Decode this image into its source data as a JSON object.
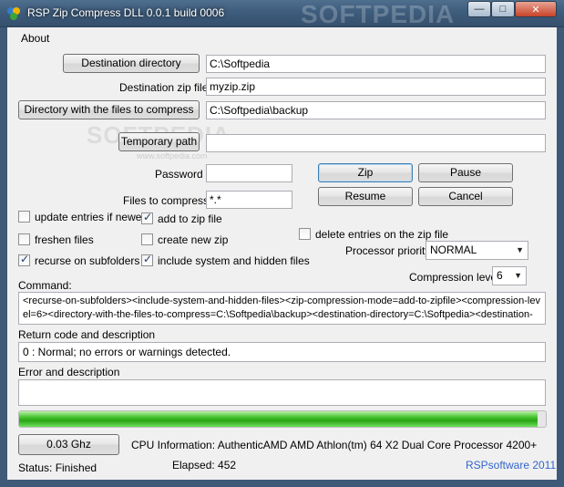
{
  "window": {
    "title": "RSP Zip Compress DLL 0.0.1 build 0006",
    "watermark": "SOFTPEDIA",
    "minimize_glyph": "—",
    "maximize_glyph": "□",
    "close_glyph": "✕"
  },
  "menu": {
    "about": "About"
  },
  "buttons": {
    "destination_directory": "Destination directory",
    "directory_with_files": "Directory with the files to compress",
    "temporary_path": "Temporary path",
    "zip": "Zip",
    "pause": "Pause",
    "resume": "Resume",
    "cancel": "Cancel",
    "cpu_speed": "0.03 Ghz"
  },
  "fields": {
    "destination_directory": "C:\\Softpedia",
    "destination_zip_file_label": "Destination zip file",
    "destination_zip_file": "myzip.zip",
    "directory_with_files": "C:\\Softpedia\\backup",
    "temporary_path": "",
    "password_label": "Password",
    "password": "",
    "files_to_compress_label": "Files to compress",
    "files_to_compress": "*.*"
  },
  "checkboxes": {
    "update_entries": {
      "label": "update entries if newer",
      "checked": false
    },
    "add_to_zip": {
      "label": "add to zip file",
      "checked": true
    },
    "freshen_files": {
      "label": "freshen files",
      "checked": false
    },
    "create_new_zip": {
      "label": "create new zip",
      "checked": false
    },
    "recurse_subfolders": {
      "label": "recurse on subfolders",
      "checked": true
    },
    "include_system_hidden": {
      "label": "include system and hidden files",
      "checked": true
    },
    "delete_entries": {
      "label": "delete entries on the zip file",
      "checked": false
    }
  },
  "selects": {
    "processor_priority_label": "Processor priority",
    "processor_priority": "NORMAL",
    "compression_level_label": "Compression level",
    "compression_level": "6"
  },
  "command": {
    "label": "Command:",
    "value": "<recurse-on-subfolders><include-system-and-hidden-files><zip-compression-mode=add-to-zipfile><compression-level=6><directory-with-the-files-to-compress=C:\\Softpedia\\backup><destination-directory=C:\\Softpedia><destination-"
  },
  "return_code": {
    "label": "Return code and description",
    "value": "0 : Normal; no errors or warnings detected."
  },
  "error": {
    "label": "Error and description",
    "value": ""
  },
  "progress": {
    "fraction": 0.985,
    "fill_color": "#2aa416"
  },
  "cpu_info": "CPU Information: AuthenticAMD AMD Athlon(tm) 64 X2 Dual Core Processor 4200+",
  "status": "Status: Finished",
  "elapsed": "Elapsed: 452",
  "credit": "RSPsoftware 2011",
  "softpedia_watermark": "SOFTPEDIA",
  "softpedia_url": "www.softpedia.com"
}
